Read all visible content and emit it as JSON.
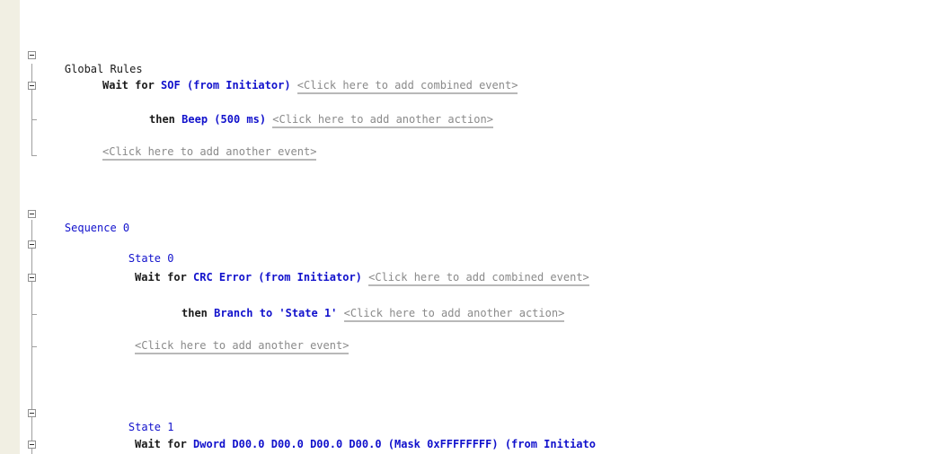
{
  "global_rules": {
    "label": "Global Rules",
    "event": {
      "wait_for": "Wait for",
      "event_name": "SOF",
      "source": "(from Initiator)",
      "add_combined": "<Click here to add combined event>",
      "then": "then",
      "action": "Beep (500 ms)",
      "add_action": "<Click here to add another action>"
    },
    "add_event": "<Click here to add another event>"
  },
  "sequence": {
    "label": "Sequence 0",
    "states": [
      {
        "label": "State 0",
        "wait_for": "Wait for",
        "event_name": "CRC Error",
        "source": "(from Initiator)",
        "add_combined": "<Click here to add combined event>",
        "then": "then",
        "action": "Branch to 'State 1'",
        "add_action": "<Click here to add another action>",
        "add_event": "<Click here to add another event>"
      },
      {
        "label": "State 1",
        "wait_for": "Wait for",
        "event_name": "Dword D00.0 D00.0 D00.0 D00.0 (Mask 0xFFFFFFFF)",
        "source": "(from Initiato"
      }
    ]
  },
  "icons": {
    "collapse": "minus-box-icon"
  }
}
